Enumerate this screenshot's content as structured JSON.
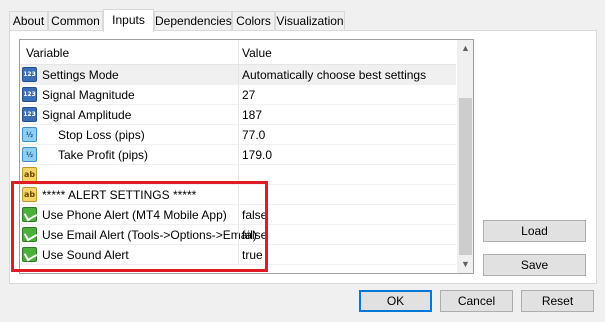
{
  "tabs": [
    {
      "label": "About"
    },
    {
      "label": "Common"
    },
    {
      "label": "Inputs"
    },
    {
      "label": "Dependencies"
    },
    {
      "label": "Colors"
    },
    {
      "label": "Visualization"
    }
  ],
  "active_tab": "Inputs",
  "grid": {
    "col_variable": "Variable",
    "col_value": "Value",
    "rows": [
      {
        "icon": "number-icon",
        "icon_text": "123",
        "name": "Settings Mode",
        "value": "Automatically choose best settings"
      },
      {
        "icon": "number-icon",
        "icon_text": "123",
        "name": "Signal Magnitude",
        "value": "27"
      },
      {
        "icon": "number-icon",
        "icon_text": "123",
        "name": "Signal Amplitude",
        "value": "187"
      },
      {
        "icon": "fraction-icon",
        "icon_text": "½",
        "name": "Stop Loss (pips)",
        "value": "77.0"
      },
      {
        "icon": "fraction-icon",
        "icon_text": "½",
        "name": "Take Profit (pips)",
        "value": "179.0"
      },
      {
        "icon": "string-icon",
        "icon_text": "ab",
        "name": "",
        "value": ""
      },
      {
        "icon": "string-icon",
        "icon_text": "ab",
        "name": "***** ALERT SETTINGS *****",
        "value": ""
      },
      {
        "icon": "bool-icon",
        "icon_text": "",
        "name": "Use Phone Alert (MT4 Mobile App)",
        "value": "false"
      },
      {
        "icon": "bool-icon",
        "icon_text": "",
        "name": "Use Email Alert (Tools->Options->Email)",
        "value": "false"
      },
      {
        "icon": "bool-icon",
        "icon_text": "",
        "name": "Use Sound Alert",
        "value": "true"
      }
    ]
  },
  "scroll_up_glyph": "▲",
  "scroll_down_glyph": "▼",
  "buttons": {
    "load": "Load",
    "save": "Save",
    "ok": "OK",
    "cancel": "Cancel",
    "reset": "Reset"
  },
  "highlight_color": "#e01b24"
}
